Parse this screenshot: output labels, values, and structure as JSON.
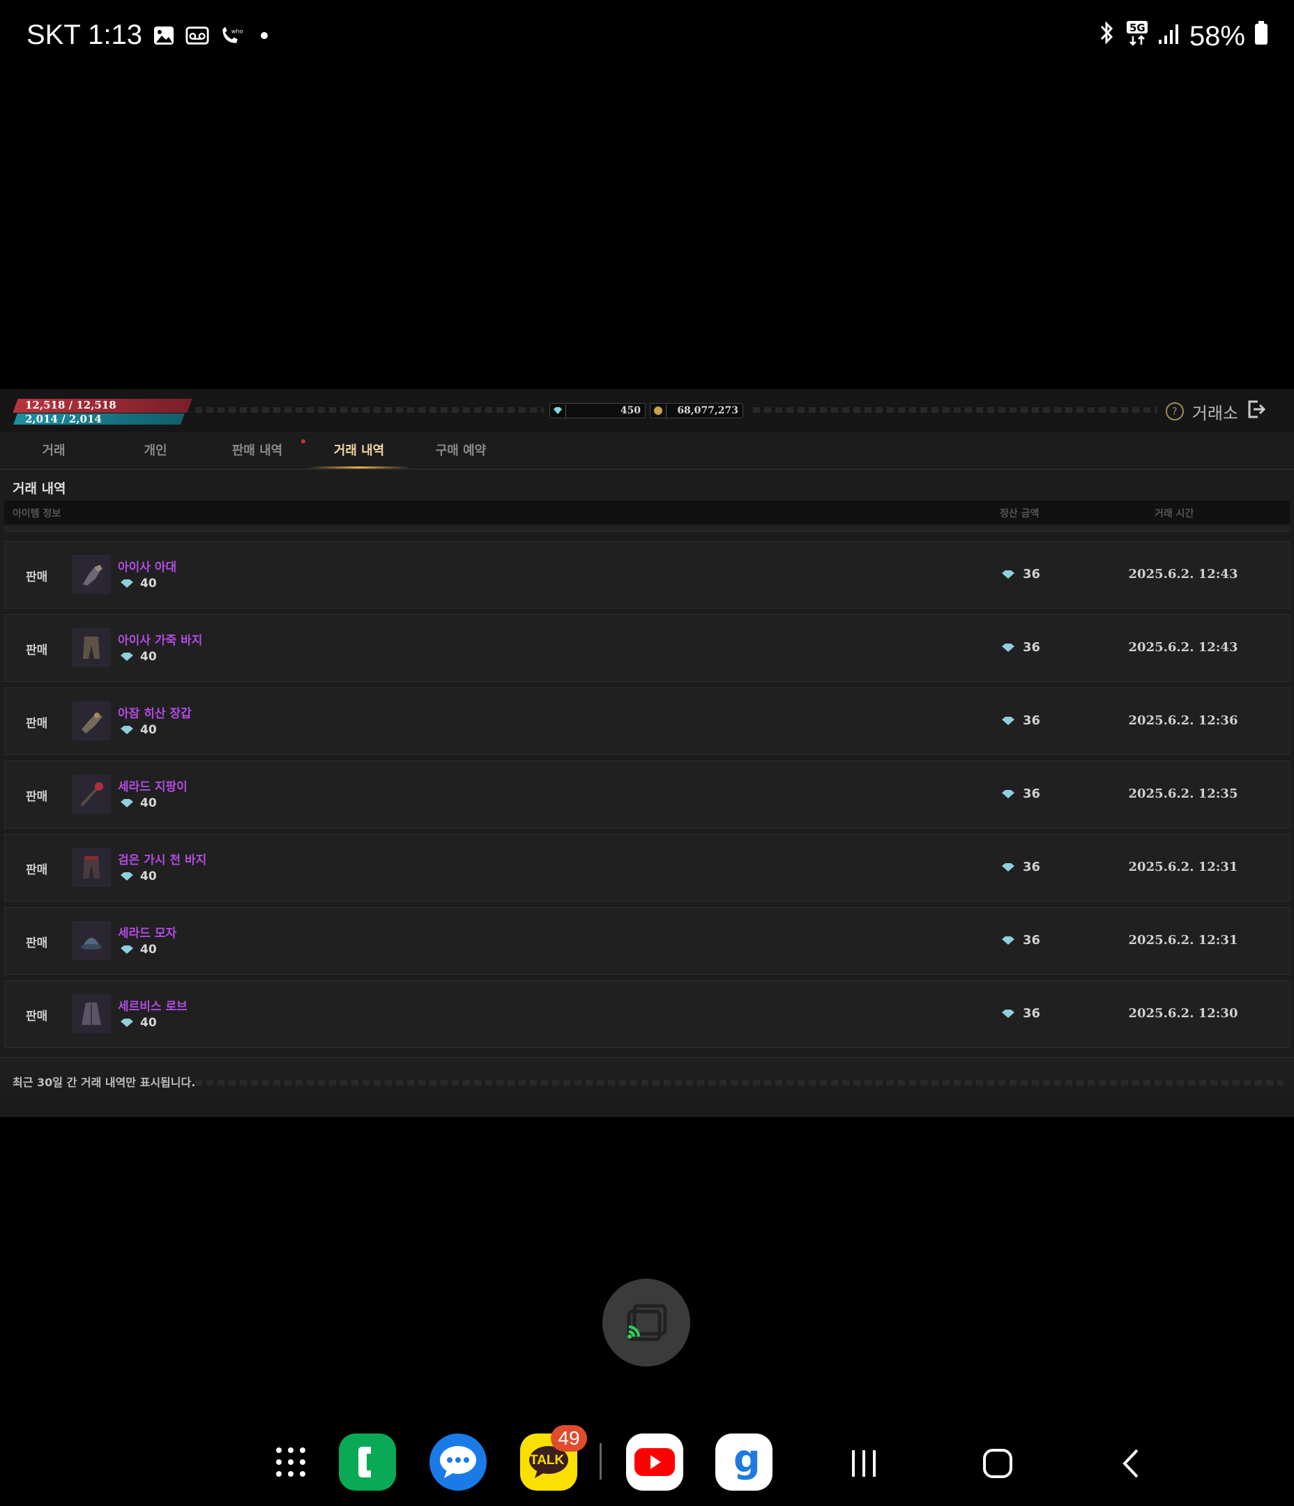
{
  "status_bar": {
    "carrier_time": "SKT 1:13",
    "battery": "58%",
    "icons_left": [
      "gallery-icon",
      "voicemail-icon",
      "whowho-call-icon",
      "dot-icon"
    ],
    "icons_right": [
      "bluetooth-icon",
      "5g-icon",
      "signal-icon",
      "battery-icon"
    ]
  },
  "game": {
    "hp": "12,518 / 12,518",
    "mp": "2,014 / 2,014",
    "diamond_balance": "450",
    "gold_balance": "68,077,273",
    "title": "거래소",
    "tabs": [
      {
        "label": "거래"
      },
      {
        "label": "개인"
      },
      {
        "label": "판매 내역"
      },
      {
        "label": "거래 내역"
      },
      {
        "label": "구매 예약"
      }
    ],
    "active_tab": "거래 내역",
    "section_title": "거래 내역",
    "columns": {
      "item": "아이템 정보",
      "settle": "정산 금액",
      "time": "거래 시간"
    },
    "rows": [
      {
        "type": "판매",
        "name": "아이사 아대",
        "price": "40",
        "settle": "36",
        "time": "2025.6.2. 12:43"
      },
      {
        "type": "판매",
        "name": "아이사 가죽 바지",
        "price": "40",
        "settle": "36",
        "time": "2025.6.2. 12:43"
      },
      {
        "type": "판매",
        "name": "아잠 히산 장갑",
        "price": "40",
        "settle": "36",
        "time": "2025.6.2. 12:36"
      },
      {
        "type": "판매",
        "name": "세라드 지팡이",
        "price": "40",
        "settle": "36",
        "time": "2025.6.2. 12:35"
      },
      {
        "type": "판매",
        "name": "검은 가시 천 바지",
        "price": "40",
        "settle": "36",
        "time": "2025.6.2. 12:31"
      },
      {
        "type": "판매",
        "name": "세라드 모자",
        "price": "40",
        "settle": "36",
        "time": "2025.6.2. 12:31"
      },
      {
        "type": "판매",
        "name": "세르비스 로브",
        "price": "40",
        "settle": "36",
        "time": "2025.6.2. 12:30"
      }
    ],
    "footer_note": "최근 30일 간 거래 내역만 표시됩니다."
  },
  "dock": {
    "kakaotalk_badge": "49",
    "kakaotalk_label": "TALK",
    "apps": [
      "app-drawer",
      "phone",
      "messages",
      "kakaotalk",
      "youtube",
      "g-app"
    ]
  },
  "colors": {
    "item_name": "#b24ce0",
    "active_tab": "#f2d7a0",
    "hp": "#b6343e",
    "mp": "#1e8fa0"
  }
}
